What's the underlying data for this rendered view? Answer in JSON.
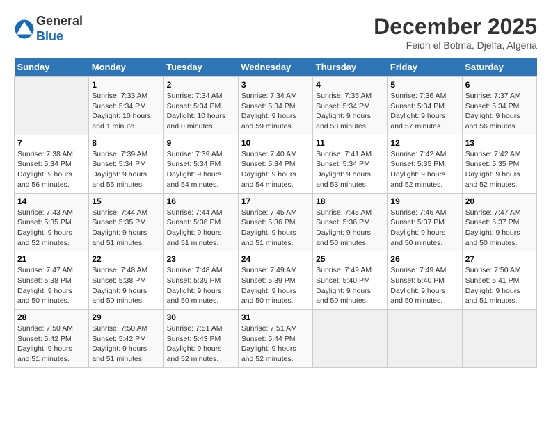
{
  "header": {
    "logo_general": "General",
    "logo_blue": "Blue",
    "month_title": "December 2025",
    "location": "Feidh el Botma, Djelfa, Algeria"
  },
  "calendar": {
    "days_of_week": [
      "Sunday",
      "Monday",
      "Tuesday",
      "Wednesday",
      "Thursday",
      "Friday",
      "Saturday"
    ],
    "weeks": [
      [
        {
          "day": "",
          "info": ""
        },
        {
          "day": "1",
          "info": "Sunrise: 7:33 AM\nSunset: 5:34 PM\nDaylight: 10 hours\nand 1 minute."
        },
        {
          "day": "2",
          "info": "Sunrise: 7:34 AM\nSunset: 5:34 PM\nDaylight: 10 hours\nand 0 minutes."
        },
        {
          "day": "3",
          "info": "Sunrise: 7:34 AM\nSunset: 5:34 PM\nDaylight: 9 hours\nand 59 minutes."
        },
        {
          "day": "4",
          "info": "Sunrise: 7:35 AM\nSunset: 5:34 PM\nDaylight: 9 hours\nand 58 minutes."
        },
        {
          "day": "5",
          "info": "Sunrise: 7:36 AM\nSunset: 5:34 PM\nDaylight: 9 hours\nand 57 minutes."
        },
        {
          "day": "6",
          "info": "Sunrise: 7:37 AM\nSunset: 5:34 PM\nDaylight: 9 hours\nand 56 minutes."
        }
      ],
      [
        {
          "day": "7",
          "info": "Sunrise: 7:38 AM\nSunset: 5:34 PM\nDaylight: 9 hours\nand 56 minutes."
        },
        {
          "day": "8",
          "info": "Sunrise: 7:39 AM\nSunset: 5:34 PM\nDaylight: 9 hours\nand 55 minutes."
        },
        {
          "day": "9",
          "info": "Sunrise: 7:39 AM\nSunset: 5:34 PM\nDaylight: 9 hours\nand 54 minutes."
        },
        {
          "day": "10",
          "info": "Sunrise: 7:40 AM\nSunset: 5:34 PM\nDaylight: 9 hours\nand 54 minutes."
        },
        {
          "day": "11",
          "info": "Sunrise: 7:41 AM\nSunset: 5:34 PM\nDaylight: 9 hours\nand 53 minutes."
        },
        {
          "day": "12",
          "info": "Sunrise: 7:42 AM\nSunset: 5:35 PM\nDaylight: 9 hours\nand 52 minutes."
        },
        {
          "day": "13",
          "info": "Sunrise: 7:42 AM\nSunset: 5:35 PM\nDaylight: 9 hours\nand 52 minutes."
        }
      ],
      [
        {
          "day": "14",
          "info": "Sunrise: 7:43 AM\nSunset: 5:35 PM\nDaylight: 9 hours\nand 52 minutes."
        },
        {
          "day": "15",
          "info": "Sunrise: 7:44 AM\nSunset: 5:35 PM\nDaylight: 9 hours\nand 51 minutes."
        },
        {
          "day": "16",
          "info": "Sunrise: 7:44 AM\nSunset: 5:36 PM\nDaylight: 9 hours\nand 51 minutes."
        },
        {
          "day": "17",
          "info": "Sunrise: 7:45 AM\nSunset: 5:36 PM\nDaylight: 9 hours\nand 51 minutes."
        },
        {
          "day": "18",
          "info": "Sunrise: 7:45 AM\nSunset: 5:36 PM\nDaylight: 9 hours\nand 50 minutes."
        },
        {
          "day": "19",
          "info": "Sunrise: 7:46 AM\nSunset: 5:37 PM\nDaylight: 9 hours\nand 50 minutes."
        },
        {
          "day": "20",
          "info": "Sunrise: 7:47 AM\nSunset: 5:37 PM\nDaylight: 9 hours\nand 50 minutes."
        }
      ],
      [
        {
          "day": "21",
          "info": "Sunrise: 7:47 AM\nSunset: 5:38 PM\nDaylight: 9 hours\nand 50 minutes."
        },
        {
          "day": "22",
          "info": "Sunrise: 7:48 AM\nSunset: 5:38 PM\nDaylight: 9 hours\nand 50 minutes."
        },
        {
          "day": "23",
          "info": "Sunrise: 7:48 AM\nSunset: 5:39 PM\nDaylight: 9 hours\nand 50 minutes."
        },
        {
          "day": "24",
          "info": "Sunrise: 7:49 AM\nSunset: 5:39 PM\nDaylight: 9 hours\nand 50 minutes."
        },
        {
          "day": "25",
          "info": "Sunrise: 7:49 AM\nSunset: 5:40 PM\nDaylight: 9 hours\nand 50 minutes."
        },
        {
          "day": "26",
          "info": "Sunrise: 7:49 AM\nSunset: 5:40 PM\nDaylight: 9 hours\nand 50 minutes."
        },
        {
          "day": "27",
          "info": "Sunrise: 7:50 AM\nSunset: 5:41 PM\nDaylight: 9 hours\nand 51 minutes."
        }
      ],
      [
        {
          "day": "28",
          "info": "Sunrise: 7:50 AM\nSunset: 5:42 PM\nDaylight: 9 hours\nand 51 minutes."
        },
        {
          "day": "29",
          "info": "Sunrise: 7:50 AM\nSunset: 5:42 PM\nDaylight: 9 hours\nand 51 minutes."
        },
        {
          "day": "30",
          "info": "Sunrise: 7:51 AM\nSunset: 5:43 PM\nDaylight: 9 hours\nand 52 minutes."
        },
        {
          "day": "31",
          "info": "Sunrise: 7:51 AM\nSunset: 5:44 PM\nDaylight: 9 hours\nand 52 minutes."
        },
        {
          "day": "",
          "info": ""
        },
        {
          "day": "",
          "info": ""
        },
        {
          "day": "",
          "info": ""
        }
      ]
    ]
  }
}
